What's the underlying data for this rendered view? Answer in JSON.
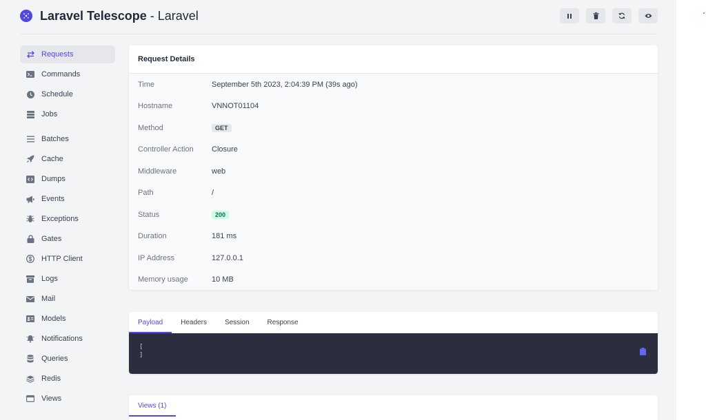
{
  "header": {
    "brand": "Laravel Telescope",
    "suffix": " - Laravel"
  },
  "toolbar": {
    "pause_icon": "pause-icon",
    "clear_icon": "trash-icon",
    "refresh_icon": "refresh-icon",
    "monitor_icon": "eye-icon"
  },
  "sidebar": {
    "items": [
      {
        "label": "Requests",
        "icon": "arrows-icon"
      },
      {
        "label": "Commands",
        "icon": "terminal-icon"
      },
      {
        "label": "Schedule",
        "icon": "clock-icon"
      },
      {
        "label": "Jobs",
        "icon": "stack-icon"
      },
      {
        "label": "Batches",
        "icon": "menu-icon"
      },
      {
        "label": "Cache",
        "icon": "rocket-icon"
      },
      {
        "label": "Dumps",
        "icon": "code-icon"
      },
      {
        "label": "Events",
        "icon": "megaphone-icon"
      },
      {
        "label": "Exceptions",
        "icon": "bug-icon"
      },
      {
        "label": "Gates",
        "icon": "lock-icon"
      },
      {
        "label": "HTTP Client",
        "icon": "dollar-circle-icon"
      },
      {
        "label": "Logs",
        "icon": "archive-icon"
      },
      {
        "label": "Mail",
        "icon": "envelope-icon"
      },
      {
        "label": "Models",
        "icon": "id-card-icon"
      },
      {
        "label": "Notifications",
        "icon": "bell-icon"
      },
      {
        "label": "Queries",
        "icon": "database-icon"
      },
      {
        "label": "Redis",
        "icon": "layers-icon"
      },
      {
        "label": "Views",
        "icon": "window-icon"
      }
    ]
  },
  "details": {
    "title": "Request Details",
    "rows": [
      {
        "label": "Time",
        "value": "September 5th 2023, 2:04:39 PM (39s ago)"
      },
      {
        "label": "Hostname",
        "value": "VNNOT01104"
      },
      {
        "label": "Method",
        "value": "GET"
      },
      {
        "label": "Controller Action",
        "value": "Closure"
      },
      {
        "label": "Middleware",
        "value": "web"
      },
      {
        "label": "Path",
        "value": "/"
      },
      {
        "label": "Status",
        "value": "200"
      },
      {
        "label": "Duration",
        "value": "181 ms"
      },
      {
        "label": "IP Address",
        "value": "127.0.0.1"
      },
      {
        "label": "Memory usage",
        "value": "10 MB"
      }
    ]
  },
  "payload": {
    "tabs": [
      "Payload",
      "Headers",
      "Session",
      "Response"
    ],
    "code": "[\n]",
    "copy_icon": "clipboard-icon"
  },
  "views": {
    "tab": "Views (1)"
  },
  "colors": {
    "accent": "#4f46e5",
    "background": "#f3f4f6",
    "code_background": "#2b2e3f",
    "status_green_bg": "#d1fae5",
    "status_green_text": "#047857"
  }
}
